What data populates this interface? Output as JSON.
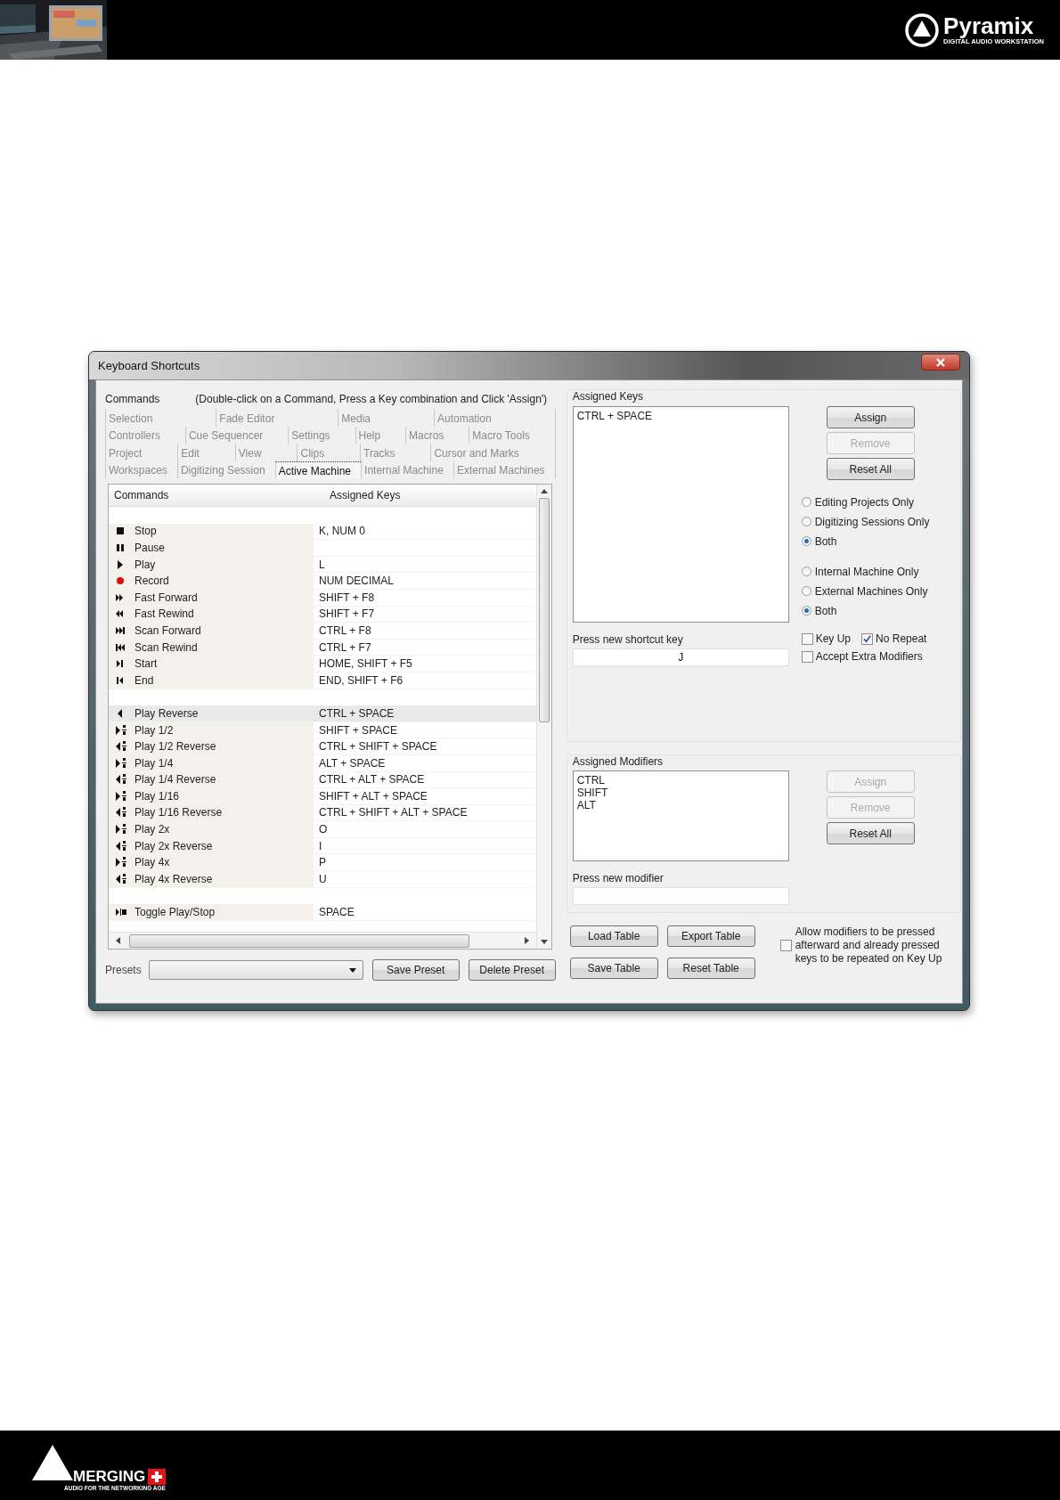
{
  "header": {
    "brand": "Pyramix",
    "tagline": "DIGITAL AUDIO WORKSTATION"
  },
  "dialog": {
    "title": "Keyboard Shortcuts",
    "commands_label": "Commands",
    "hint": "(Double-click on a Command, Press a Key combination and Click 'Assign')",
    "tab_rows": [
      {
        "tabs": [
          {
            "label": "Selection",
            "selected": false
          },
          {
            "label": "Fade Editor",
            "selected": false
          },
          {
            "label": "Media",
            "selected": false
          },
          {
            "label": "Automation",
            "selected": false
          }
        ]
      },
      {
        "tabs": [
          {
            "label": "Controllers",
            "selected": false
          },
          {
            "label": "Cue Sequencer",
            "selected": false
          },
          {
            "label": "Settings",
            "selected": false
          },
          {
            "label": "Help",
            "selected": false
          },
          {
            "label": "Macros",
            "selected": false
          },
          {
            "label": "Macro Tools",
            "selected": false
          }
        ]
      },
      {
        "tabs": [
          {
            "label": "Project",
            "selected": false
          },
          {
            "label": "Edit",
            "selected": false
          },
          {
            "label": "View",
            "selected": false
          },
          {
            "label": "Clips",
            "selected": false
          },
          {
            "label": "Tracks",
            "selected": false
          },
          {
            "label": "Cursor and Marks",
            "selected": false
          }
        ]
      },
      {
        "tabs": [
          {
            "label": "Workspaces",
            "selected": false
          },
          {
            "label": "Digitizing Session",
            "selected": false
          },
          {
            "label": "Active Machine",
            "selected": true
          },
          {
            "label": "Internal Machine",
            "selected": false
          },
          {
            "label": "External Machines",
            "selected": false
          }
        ]
      }
    ],
    "table": {
      "columns": [
        "Commands",
        "Assigned Keys"
      ],
      "rows": [
        {
          "kind": "blank",
          "selected": false
        },
        {
          "kind": "stop",
          "command": "Stop",
          "keys": "K, NUM 0",
          "selected": false
        },
        {
          "kind": "pause",
          "command": "Pause",
          "selected": false
        },
        {
          "kind": "play",
          "command": "Play",
          "keys": "L",
          "selected": false
        },
        {
          "kind": "record",
          "command": "Record",
          "keys": "NUM DECIMAL",
          "selected": false
        },
        {
          "kind": "ff",
          "command": "Fast Forward",
          "keys": "SHIFT + F8",
          "selected": false
        },
        {
          "kind": "rew",
          "command": "Fast Rewind",
          "keys": "SHIFT + F7",
          "selected": false
        },
        {
          "kind": "scanfwd",
          "command": "Scan Forward",
          "keys": "CTRL + F8",
          "selected": false
        },
        {
          "kind": "scanrew",
          "command": "Scan Rewind",
          "keys": "CTRL + F7",
          "selected": false
        },
        {
          "kind": "start",
          "command": "Start",
          "keys": "HOME, SHIFT + F5",
          "selected": false
        },
        {
          "kind": "end",
          "command": "End",
          "keys": "END, SHIFT + F6",
          "selected": false
        },
        {
          "kind": "blank",
          "selected": false
        },
        {
          "kind": "reverse",
          "command": "Play Reverse",
          "keys": "CTRL + SPACE",
          "selected": true
        },
        {
          "kind": "varifwd",
          "command": "Play 1/2",
          "keys": "SHIFT + SPACE",
          "selected": false
        },
        {
          "kind": "varirev",
          "command": "Play 1/2 Reverse",
          "keys": "CTRL + SHIFT + SPACE",
          "selected": false
        },
        {
          "kind": "varifwd",
          "command": "Play 1/4",
          "keys": "ALT + SPACE",
          "selected": false
        },
        {
          "kind": "varirev",
          "command": "Play 1/4 Reverse",
          "keys": "CTRL + ALT + SPACE",
          "selected": false
        },
        {
          "kind": "varifwd",
          "command": "Play 1/16",
          "keys": "SHIFT + ALT + SPACE",
          "selected": false
        },
        {
          "kind": "varirev",
          "command": "Play 1/16 Reverse",
          "keys": "CTRL + SHIFT + ALT + SPACE",
          "selected": false
        },
        {
          "kind": "varifwd",
          "command": "Play 2x",
          "keys": "O",
          "selected": false
        },
        {
          "kind": "varirev",
          "command": "Play 2x Reverse",
          "keys": "I",
          "selected": false
        },
        {
          "kind": "varifwd",
          "command": "Play 4x",
          "keys": "P",
          "selected": false
        },
        {
          "kind": "varirev",
          "command": "Play 4x Reverse",
          "keys": "U",
          "selected": false
        },
        {
          "kind": "blank",
          "selected": false
        },
        {
          "kind": "toggle",
          "command": "Toggle Play/Stop",
          "keys": "SPACE",
          "selected": false
        }
      ]
    },
    "presets": {
      "label": "Presets",
      "buttons": [
        "Save Preset",
        "Delete Preset"
      ]
    },
    "assigned_keys": {
      "label": "Assigned Keys",
      "items": [
        "CTRL + SPACE"
      ],
      "buttons": [
        {
          "label": "Assign",
          "disabled": false
        },
        {
          "label": "Remove",
          "disabled": true
        },
        {
          "label": "Reset All",
          "disabled": false
        }
      ]
    },
    "scope_groups": [
      {
        "options": [
          {
            "label": "Editing Projects Only",
            "selected": false
          },
          {
            "label": "Digitizing Sessions Only",
            "selected": false
          },
          {
            "label": "Both",
            "selected": true
          }
        ]
      },
      {
        "options": [
          {
            "label": "Internal Machine Only",
            "selected": false
          },
          {
            "label": "External Machines Only",
            "selected": false
          },
          {
            "label": "Both",
            "selected": true
          }
        ]
      }
    ],
    "shortcut_field": {
      "label": "Press new shortcut key",
      "value": "J"
    },
    "checkboxes": [
      {
        "label": "Key Up",
        "checked": false
      },
      {
        "label": "No Repeat",
        "checked": true
      },
      {
        "label": "Accept Extra Modifiers",
        "checked": false
      }
    ],
    "assigned_modifiers": {
      "label": "Assigned Modifiers",
      "items": [
        "CTRL",
        "SHIFT",
        "ALT"
      ],
      "buttons": [
        {
          "label": "Assign",
          "disabled": true
        },
        {
          "label": "Remove",
          "disabled": true
        },
        {
          "label": "Reset All",
          "disabled": false
        }
      ]
    },
    "modifier_field": {
      "label": "Press new modifier"
    },
    "table_buttons": [
      "Load Table",
      "Export Table",
      "Save Table",
      "Reset Table"
    ],
    "repeat_option": {
      "label": "Allow modifiers to be pressed afterward and already pressed keys to be repeated on Key Up",
      "checked": false
    }
  },
  "footer": {
    "brand": "MERGING",
    "tagline": "AUDIO FOR THE NETWORKING AGE"
  }
}
